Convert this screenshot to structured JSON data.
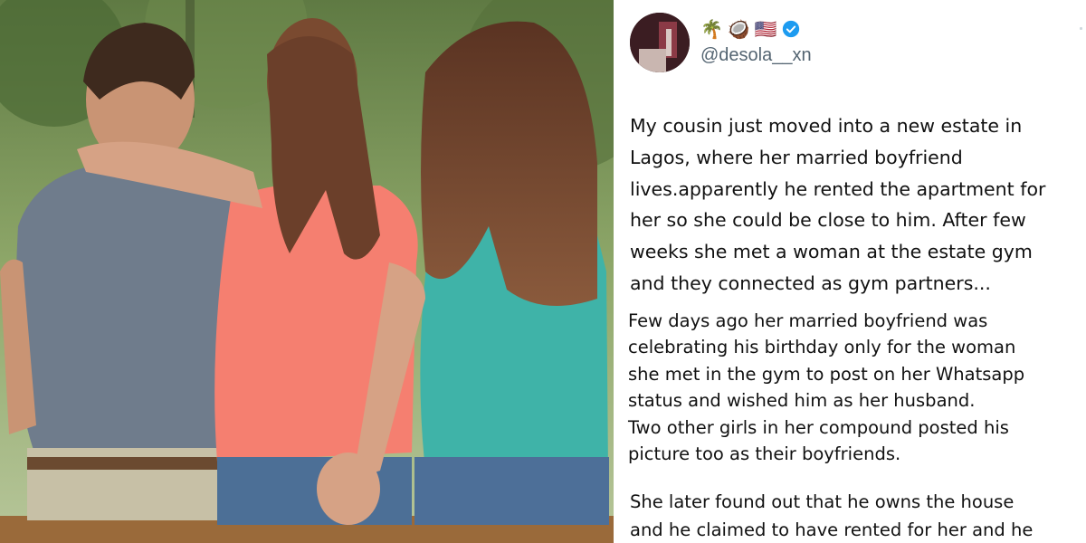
{
  "profile": {
    "emojis": [
      "🌴",
      "🥥",
      "🇺🇸"
    ],
    "handle": "@desola__xn",
    "verified": true,
    "verified_color": "#1d9bf0"
  },
  "tweet": {
    "paragraph1": [
      "My cousin just moved into a new estate in",
      "Lagos, where her married boyfriend",
      "lives.apparently he rented the apartment for",
      "her so she could be close to him. After few",
      "weeks she met a woman at the estate gym",
      "and they connected as gym partners..."
    ],
    "paragraph2": [
      "Few days ago her married boyfriend was",
      "celebrating his birthday only for the woman",
      "she met in the gym to post on her Whatsapp",
      "status and wished him as her husband.",
      "Two other girls in her compound posted his",
      "picture too as their boyfriends."
    ],
    "paragraph3": [
      "She later found out that he owns the house",
      "and he claimed to have rented for her and he"
    ]
  },
  "photo": {
    "description_icon": "photo-three-people-on-bench",
    "colors": {
      "shirt_man": "#6f7c8c",
      "top_middle": "#f57f70",
      "top_right": "#3fb3a8",
      "hair": "#6b3f2a"
    }
  }
}
